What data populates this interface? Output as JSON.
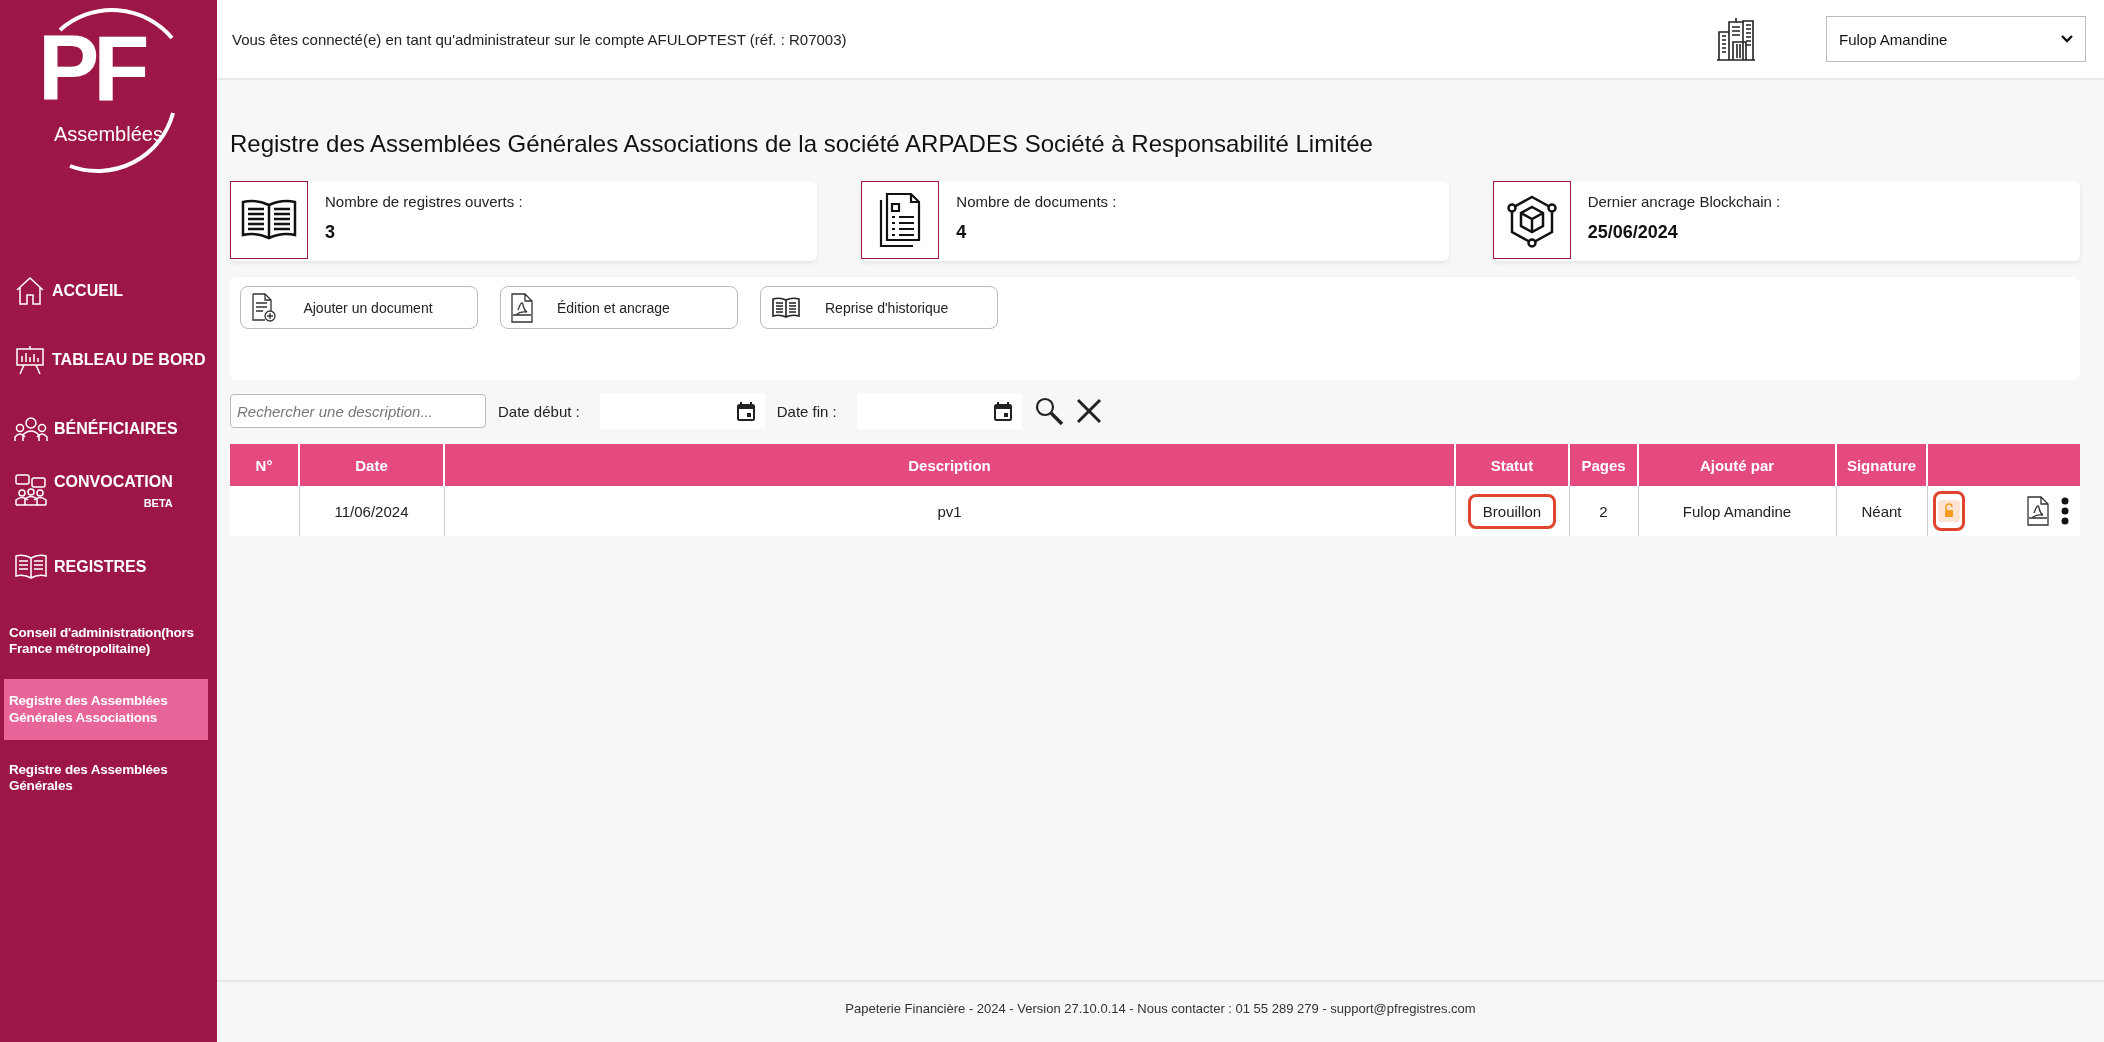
{
  "sidebar": {
    "logo": {
      "letters": "PF",
      "subtitle": "Assemblées"
    },
    "nav": [
      {
        "label": "ACCUEIL"
      },
      {
        "label": "TABLEAU DE BORD"
      },
      {
        "label": "BÉNÉFICIAIRES"
      },
      {
        "label": "CONVOCATION",
        "badge": "BETA"
      },
      {
        "label": "REGISTRES"
      }
    ],
    "registers": [
      {
        "label": "Conseil d'administration(hors France métropolitaine)",
        "selected": false
      },
      {
        "label": "Registre des Assemblées Générales Associations",
        "selected": true
      },
      {
        "label": "Registre des Assemblées Générales",
        "selected": false
      }
    ]
  },
  "header": {
    "account_notice": "Vous êtes connecté(e) en tant qu'administrateur sur le compte AFULOPTEST (réf. : R07003)",
    "user_select": {
      "value": "Fulop Amandine"
    }
  },
  "page_title": "Registre des Assemblées Générales Associations de la société ARPADES Société à Responsabilité Limitée",
  "stats": [
    {
      "label": "Nombre de registres ouverts :",
      "value": "3"
    },
    {
      "label": "Nombre de documents :",
      "value": "4"
    },
    {
      "label": "Dernier ancrage Blockchain :",
      "value": "25/06/2024"
    }
  ],
  "actions": [
    {
      "label": "Ajouter un document"
    },
    {
      "label": "Édition et ancrage"
    },
    {
      "label": "Reprise d'historique"
    }
  ],
  "filters": {
    "search": {
      "placeholder": "Rechercher une description..."
    },
    "start_label": "Date début :",
    "end_label": "Date fin :"
  },
  "table": {
    "columns": [
      "N°",
      "Date",
      "Description",
      "Statut",
      "Pages",
      "Ajouté par",
      "Signature"
    ],
    "rows": [
      {
        "date": "11/06/2024",
        "description": "pv1",
        "status": "Brouillon",
        "pages": "2",
        "added_by": "Fulop Amandine",
        "signature": "Néant"
      }
    ]
  },
  "footer": "Papeterie Financière - 2024 - Version 27.10.0.14 - Nous contacter : 01 55 289 279 - support@pfregistres.com"
}
